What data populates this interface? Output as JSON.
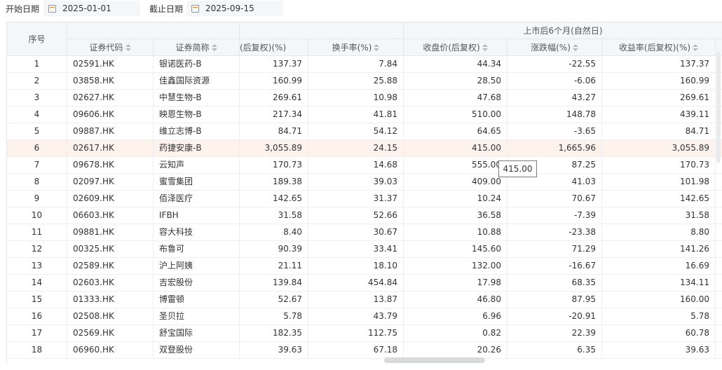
{
  "filters": {
    "start_label": "开始日期",
    "start_value": "2025-01-01",
    "end_label": "截止日期",
    "end_value": "2025-09-15"
  },
  "table": {
    "group_header": "上市后6个月(自然日)",
    "headers": {
      "seq": "序号",
      "code": "证券代码",
      "name": "证券简称",
      "ret_partial": "(后复权)(%)",
      "turnover": "换手率(%)",
      "close": "收盘价(后复权)",
      "change": "涨跌幅(%)",
      "ret": "收益率(后复权)(%)"
    },
    "rows": [
      {
        "seq": "1",
        "code": "02591.HK",
        "name": "银诺医药-B",
        "ret_partial": "137.37",
        "turnover": "7.84",
        "close": "44.34",
        "change": "-22.55",
        "ret": "137.37"
      },
      {
        "seq": "2",
        "code": "03858.HK",
        "name": "佳鑫国际资源",
        "ret_partial": "160.99",
        "turnover": "25.88",
        "close": "28.50",
        "change": "-6.06",
        "ret": "160.99"
      },
      {
        "seq": "3",
        "code": "02627.HK",
        "name": "中慧生物-B",
        "ret_partial": "269.61",
        "turnover": "10.98",
        "close": "47.68",
        "change": "43.27",
        "ret": "269.61"
      },
      {
        "seq": "4",
        "code": "09606.HK",
        "name": "映恩生物-B",
        "ret_partial": "217.34",
        "turnover": "41.81",
        "close": "510.00",
        "change": "148.78",
        "ret": "439.11"
      },
      {
        "seq": "5",
        "code": "09887.HK",
        "name": "维立志博-B",
        "ret_partial": "84.71",
        "turnover": "54.12",
        "close": "64.65",
        "change": "-3.65",
        "ret": "84.71"
      },
      {
        "seq": "6",
        "code": "02617.HK",
        "name": "药捷安康-B",
        "ret_partial": "3,055.89",
        "turnover": "24.15",
        "close": "415.00",
        "change": "1,665.96",
        "ret": "3,055.89"
      },
      {
        "seq": "7",
        "code": "09678.HK",
        "name": "云知声",
        "ret_partial": "170.73",
        "turnover": "14.68",
        "close": "555.00",
        "change": "87.25",
        "ret": "170.73"
      },
      {
        "seq": "8",
        "code": "02097.HK",
        "name": "蜜雪集团",
        "ret_partial": "189.38",
        "turnover": "39.03",
        "close": "409.00",
        "change": "41.03",
        "ret": "101.98"
      },
      {
        "seq": "9",
        "code": "02609.HK",
        "name": "佰泽医疗",
        "ret_partial": "142.65",
        "turnover": "31.37",
        "close": "10.24",
        "change": "70.67",
        "ret": "142.65"
      },
      {
        "seq": "10",
        "code": "06603.HK",
        "name": "IFBH",
        "ret_partial": "31.58",
        "turnover": "52.66",
        "close": "36.58",
        "change": "-7.39",
        "ret": "31.58"
      },
      {
        "seq": "11",
        "code": "09881.HK",
        "name": "容大科技",
        "ret_partial": "8.40",
        "turnover": "30.67",
        "close": "10.88",
        "change": "-23.38",
        "ret": "8.80"
      },
      {
        "seq": "12",
        "code": "00325.HK",
        "name": "布鲁可",
        "ret_partial": "90.39",
        "turnover": "33.41",
        "close": "145.60",
        "change": "71.29",
        "ret": "141.26"
      },
      {
        "seq": "13",
        "code": "02589.HK",
        "name": "沪上阿姨",
        "ret_partial": "21.11",
        "turnover": "18.10",
        "close": "132.00",
        "change": "-16.67",
        "ret": "16.69"
      },
      {
        "seq": "14",
        "code": "02603.HK",
        "name": "吉宏股份",
        "ret_partial": "139.84",
        "turnover": "454.84",
        "close": "17.98",
        "change": "68.35",
        "ret": "134.11"
      },
      {
        "seq": "15",
        "code": "01333.HK",
        "name": "博雷顿",
        "ret_partial": "52.67",
        "turnover": "13.87",
        "close": "46.80",
        "change": "87.95",
        "ret": "160.00"
      },
      {
        "seq": "16",
        "code": "02508.HK",
        "name": "圣贝拉",
        "ret_partial": "5.78",
        "turnover": "43.79",
        "close": "6.96",
        "change": "-20.91",
        "ret": "5.78"
      },
      {
        "seq": "17",
        "code": "02569.HK",
        "name": "舒宝国际",
        "ret_partial": "182.35",
        "turnover": "112.75",
        "close": "0.82",
        "change": "22.39",
        "ret": "60.78"
      },
      {
        "seq": "18",
        "code": "06960.HK",
        "name": "双登股份",
        "ret_partial": "39.63",
        "turnover": "67.18",
        "close": "20.26",
        "change": "6.35",
        "ret": "39.63"
      }
    ],
    "highlighted_row": 6
  },
  "tooltip": {
    "value": "415.00"
  },
  "colors": {
    "highlight_row": "#fdf3ec",
    "header_bg": "#f4f6f9",
    "calendar_icon": "#d98a2e"
  }
}
